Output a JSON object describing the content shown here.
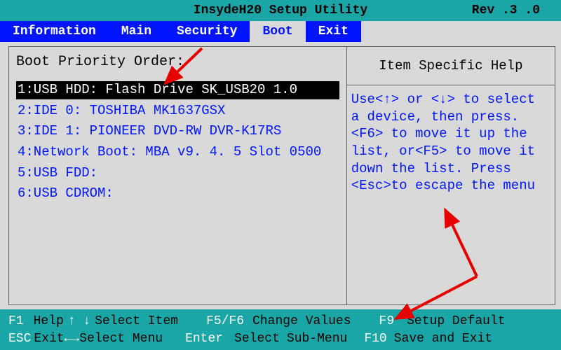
{
  "title": "InsydeH20  Setup  Utility",
  "revision": "Rev .3 .0",
  "tabs": {
    "information": "Information",
    "main": "Main",
    "security": "Security",
    "boot": "Boot",
    "exit": "Exit",
    "active": "boot"
  },
  "boot_heading": "Boot Priority Order:",
  "boot_items": [
    "1:USB HDD:  Flash Drive  SK_USB20  1.0",
    "2:IDE 0: TOSHIBA MK1637GSX",
    "3:IDE 1: PIONEER DVD-RW  DVR-K17RS",
    "4:Network Boot:  MBA  v9. 4. 5  Slot  0500",
    "5:USB FDD:",
    "6:USB CDROM:"
  ],
  "selected_index": 0,
  "help_title": "Item Specific Help",
  "help_body": "Use<↑> or <↓> to select a device,  then press. <F6> to move it up the list, or<F5> to move it down the list. Press <Esc>to escape the menu",
  "footer": {
    "f1_key": "F1",
    "f1_lbl": "Help",
    "select_item": "Select Item",
    "f5f6_key": "F5/F6",
    "f5f6_lbl": "Change Values",
    "f9_key": "F9",
    "f9_lbl": "Setup Default",
    "esc_key": "ESC",
    "esc_lbl": "Exit",
    "select_menu": "Select Menu",
    "enter_key": "Enter",
    "enter_lbl": "Select",
    "submenu_lbl": "Sub-Menu",
    "f10_key": "F10",
    "f10_lbl": "Save and Exit"
  }
}
